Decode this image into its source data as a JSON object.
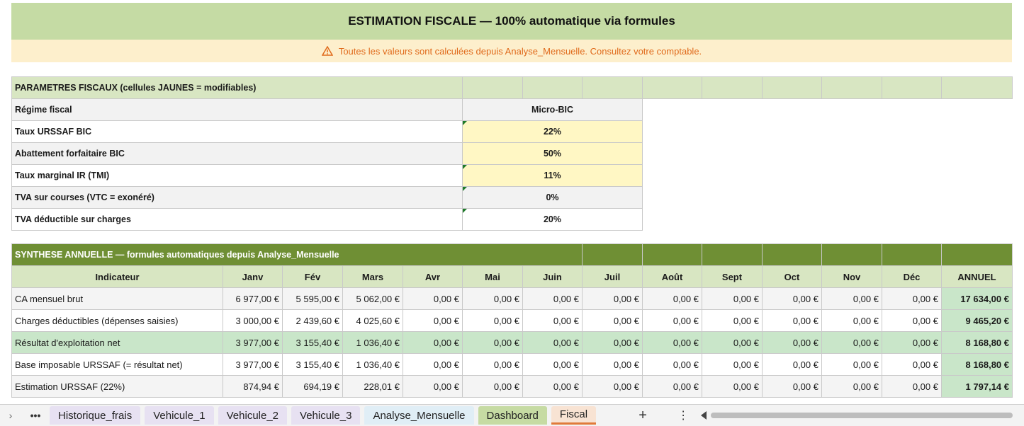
{
  "banner": {
    "title": "ESTIMATION FISCALE  —  100% automatique via formules",
    "warning": "Toutes les valeurs sont calculées depuis Analyse_Mensuelle. Consultez votre comptable."
  },
  "params": {
    "header": "PARAMETRES FISCAUX (cellules JAUNES = modifiables)",
    "rows": [
      {
        "label": "Régime fiscal",
        "value": "Micro-BIC"
      },
      {
        "label": "Taux URSSAF BIC",
        "value": "22%"
      },
      {
        "label": "Abattement forfaitaire BIC",
        "value": "50%"
      },
      {
        "label": "Taux marginal IR (TMI)",
        "value": "11%"
      },
      {
        "label": "TVA sur courses (VTC = exonéré)",
        "value": "0%"
      },
      {
        "label": "TVA déductible sur charges",
        "value": "20%"
      }
    ]
  },
  "synth": {
    "header": "SYNTHESE ANNUELLE — formules automatiques depuis Analyse_Mensuelle",
    "columns": [
      "Indicateur",
      "Janv",
      "Fév",
      "Mars",
      "Avr",
      "Mai",
      "Juin",
      "Juil",
      "Août",
      "Sept",
      "Oct",
      "Nov",
      "Déc",
      "ANNUEL"
    ],
    "rows": [
      {
        "label": "CA mensuel brut",
        "values": [
          "6 977,00 €",
          "5 595,00 €",
          "5 062,00 €",
          "0,00 €",
          "0,00 €",
          "0,00 €",
          "0,00 €",
          "0,00 €",
          "0,00 €",
          "0,00 €",
          "0,00 €",
          "0,00 €"
        ],
        "annual": "17 634,00 €"
      },
      {
        "label": "Charges déductibles (dépenses saisies)",
        "values": [
          "3 000,00 €",
          "2 439,60 €",
          "4 025,60 €",
          "0,00 €",
          "0,00 €",
          "0,00 €",
          "0,00 €",
          "0,00 €",
          "0,00 €",
          "0,00 €",
          "0,00 €",
          "0,00 €"
        ],
        "annual": "9 465,20 €"
      },
      {
        "label": "Résultat d'exploitation net",
        "values": [
          "3 977,00 €",
          "3 155,40 €",
          "1 036,40 €",
          "0,00 €",
          "0,00 €",
          "0,00 €",
          "0,00 €",
          "0,00 €",
          "0,00 €",
          "0,00 €",
          "0,00 €",
          "0,00 €"
        ],
        "annual": "8 168,80 €"
      },
      {
        "label": "Base imposable URSSAF (= résultat net)",
        "values": [
          "3 977,00 €",
          "3 155,40 €",
          "1 036,40 €",
          "0,00 €",
          "0,00 €",
          "0,00 €",
          "0,00 €",
          "0,00 €",
          "0,00 €",
          "0,00 €",
          "0,00 €",
          "0,00 €"
        ],
        "annual": "8 168,80 €"
      },
      {
        "label": "Estimation URSSAF (22%)",
        "values": [
          "874,94 €",
          "694,19 €",
          "228,01 €",
          "0,00 €",
          "0,00 €",
          "0,00 €",
          "0,00 €",
          "0,00 €",
          "0,00 €",
          "0,00 €",
          "0,00 €",
          "0,00 €"
        ],
        "annual": "1 797,14 €"
      }
    ]
  },
  "tabs": [
    {
      "label": "Historique_frais"
    },
    {
      "label": "Vehicule_1"
    },
    {
      "label": "Vehicule_2"
    },
    {
      "label": "Vehicule_3"
    },
    {
      "label": "Analyse_Mensuelle"
    },
    {
      "label": "Dashboard"
    },
    {
      "label": "Fiscal"
    }
  ],
  "tabbar": {
    "more": "•••",
    "add": "+",
    "menu": "⋮",
    "prev": "›"
  },
  "colors": {
    "accent_green": "#6f8f34",
    "header_green": "#c5dba4",
    "warning_orange": "#e06a1b",
    "editable_yellow": "#fff7c4",
    "result_green": "#c9e6c9"
  }
}
